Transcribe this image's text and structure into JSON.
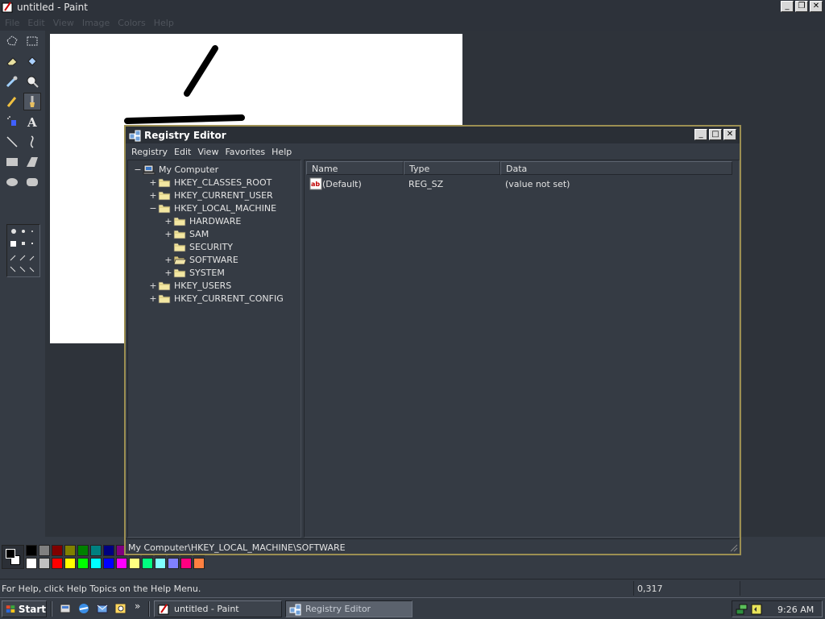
{
  "paint": {
    "title": "untitled - Paint",
    "menu": [
      "File",
      "Edit",
      "View",
      "Image",
      "Colors",
      "Help"
    ],
    "status_help": "For Help, click Help Topics on the Help Menu.",
    "status_coords": "0,317",
    "palette_colors_row1": [
      "#000000",
      "#808080",
      "#800000",
      "#808000",
      "#008000",
      "#008080",
      "#000080",
      "#800080",
      "#808040",
      "#004040",
      "#0080ff",
      "#004080",
      "#4000ff",
      "#804000"
    ],
    "palette_colors_row2": [
      "#ffffff",
      "#c0c0c0",
      "#ff0000",
      "#ffff00",
      "#00ff00",
      "#00ffff",
      "#0000ff",
      "#ff00ff",
      "#ffff80",
      "#00ff80",
      "#80ffff",
      "#8080ff",
      "#ff0080",
      "#ff8040"
    ]
  },
  "regedit": {
    "title": "Registry Editor",
    "menu": [
      "Registry",
      "Edit",
      "View",
      "Favorites",
      "Help"
    ],
    "tree": [
      {
        "label": "My Computer",
        "expander": "−",
        "depth": 0,
        "icon": "computer-icon"
      },
      {
        "label": "HKEY_CLASSES_ROOT",
        "expander": "+",
        "depth": 1,
        "icon": "folder-icon"
      },
      {
        "label": "HKEY_CURRENT_USER",
        "expander": "+",
        "depth": 1,
        "icon": "folder-icon"
      },
      {
        "label": "HKEY_LOCAL_MACHINE",
        "expander": "−",
        "depth": 1,
        "icon": "folder-icon"
      },
      {
        "label": "HARDWARE",
        "expander": "+",
        "depth": 2,
        "icon": "folder-icon"
      },
      {
        "label": "SAM",
        "expander": "+",
        "depth": 2,
        "icon": "folder-icon"
      },
      {
        "label": "SECURITY",
        "expander": "",
        "depth": 2,
        "icon": "folder-icon"
      },
      {
        "label": "SOFTWARE",
        "expander": "+",
        "depth": 2,
        "icon": "open-folder-icon"
      },
      {
        "label": "SYSTEM",
        "expander": "+",
        "depth": 2,
        "icon": "folder-icon"
      },
      {
        "label": "HKEY_USERS",
        "expander": "+",
        "depth": 1,
        "icon": "folder-icon"
      },
      {
        "label": "HKEY_CURRENT_CONFIG",
        "expander": "+",
        "depth": 1,
        "icon": "folder-icon"
      }
    ],
    "columns": [
      "Name",
      "Type",
      "Data"
    ],
    "values": [
      {
        "name": "(Default)",
        "type": "REG_SZ",
        "data": "(value not set)"
      }
    ],
    "status_path": "My Computer\\HKEY_LOCAL_MACHINE\\SOFTWARE"
  },
  "taskbar": {
    "start_label": "Start",
    "quick_launch_more": "»",
    "tasks": [
      {
        "label": "untitled - Paint",
        "active": false
      },
      {
        "label": "Registry Editor",
        "active": true
      }
    ],
    "clock": "9:26 AM"
  }
}
